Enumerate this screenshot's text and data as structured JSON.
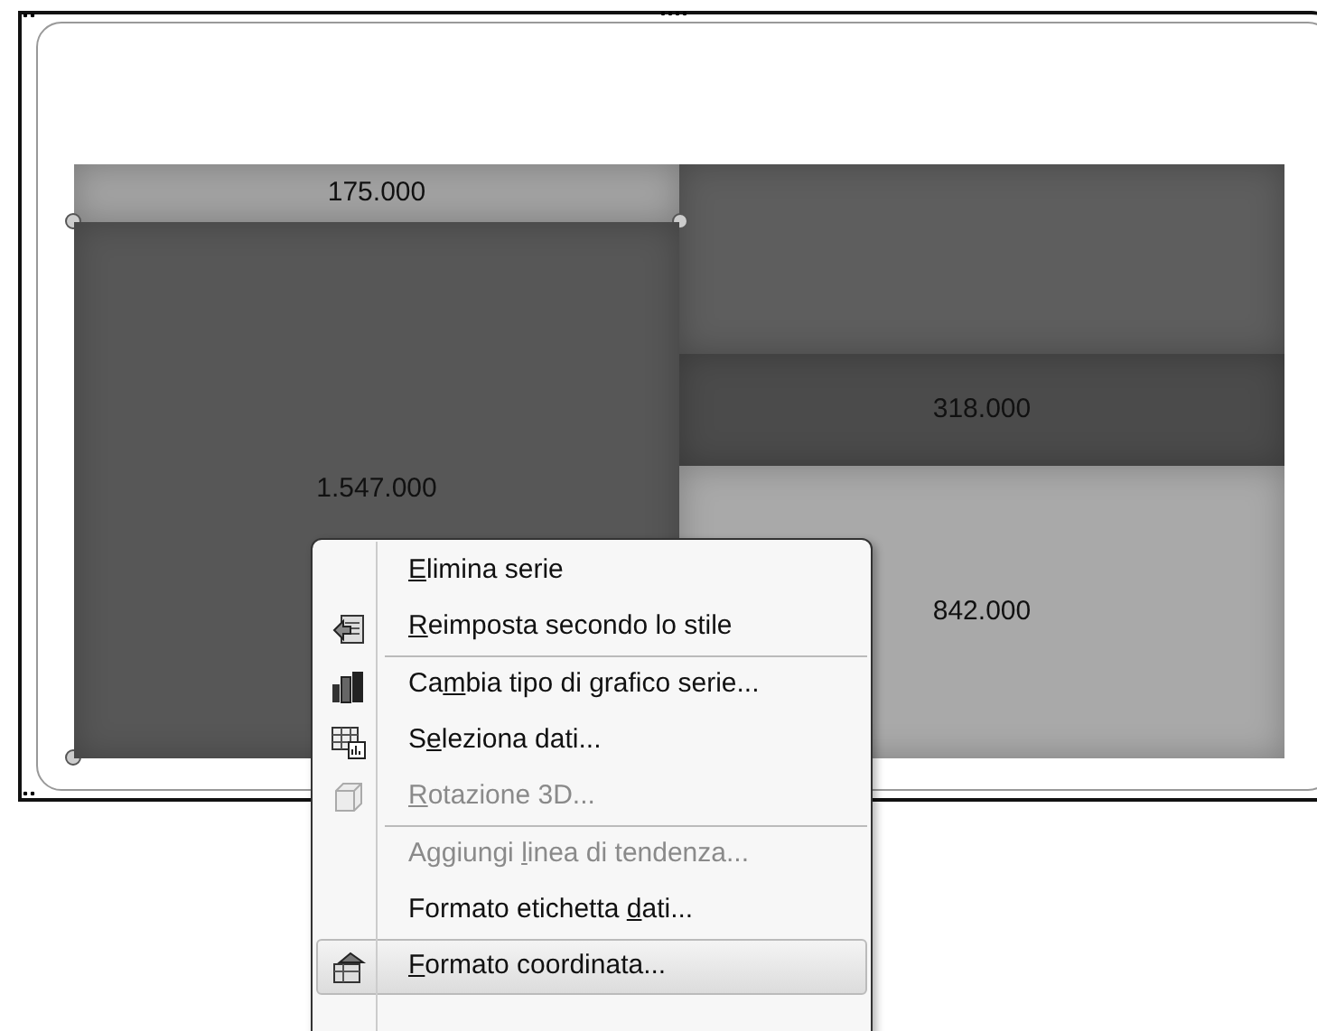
{
  "chart": {
    "columns": [
      {
        "segments": [
          {
            "label": "175.000",
            "color": "#a3a3a3",
            "selected": false
          },
          {
            "label": "1.547.000",
            "color": "#575757",
            "selected": true
          }
        ]
      },
      {
        "segments": [
          {
            "color": "#5e5e5e",
            "selected": false
          },
          {
            "label": "318.000",
            "color": "#4b4b4b",
            "selected": false
          },
          {
            "label": "842.000",
            "color": "#a9a9a9",
            "selected": false
          }
        ]
      }
    ]
  },
  "context_menu": {
    "items": [
      {
        "mnemonic": "E",
        "after": "limina serie",
        "kind": "plain",
        "disabled": false,
        "highlighted": false,
        "separator_after": false
      },
      {
        "mnemonic": "R",
        "after": "eimposta secondo lo stile",
        "kind": "reset",
        "disabled": false,
        "highlighted": false,
        "separator_after": true
      },
      {
        "before": "Ca",
        "mnemonic": "m",
        "after": "bia tipo di grafico serie...",
        "kind": "chart",
        "disabled": false,
        "highlighted": false,
        "separator_after": false
      },
      {
        "before": "S",
        "mnemonic": "e",
        "after": "leziona dati...",
        "kind": "table",
        "disabled": false,
        "highlighted": false,
        "separator_after": false
      },
      {
        "mnemonic": "R",
        "after": "otazione 3D...",
        "kind": "cube",
        "disabled": true,
        "highlighted": false,
        "separator_after": true
      },
      {
        "before": "Aggiungi ",
        "mnemonic": "l",
        "after": "inea di tendenza...",
        "kind": "plain",
        "disabled": true,
        "highlighted": false,
        "separator_after": false
      },
      {
        "before": "Formato etichetta ",
        "mnemonic": "d",
        "after": "ati...",
        "kind": "plain",
        "disabled": false,
        "highlighted": false,
        "separator_after": false
      },
      {
        "mnemonic": "F",
        "after": "ormato coordinata...",
        "kind": "format",
        "disabled": false,
        "highlighted": true,
        "separator_after": false
      }
    ]
  }
}
